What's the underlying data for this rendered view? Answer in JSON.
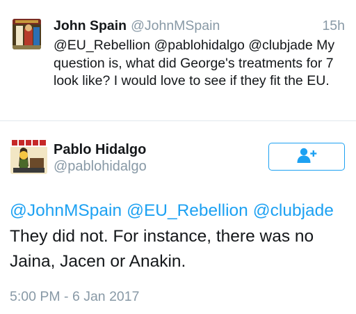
{
  "reply_tweet": {
    "author_name": "John Spain",
    "author_handle": "@JohnMSpain",
    "time_ago": "15h",
    "text": "@EU_Rebellion @pablohidalgo @clubjade My question is, what did George's treatments for 7 look like?  I would love to see if they fit the EU."
  },
  "main_tweet": {
    "author_name": "Pablo Hidalgo",
    "author_handle": "@pablohidalgo",
    "follow_icon": "add-user-icon",
    "mentions": [
      "@JohnMSpain",
      "@EU_Rebellion",
      "@clubjade"
    ],
    "text": "They did not. For instance, there was no Jaina, Jacen or Anakin.",
    "timestamp": "5:00 PM - 6 Jan 2017"
  },
  "colors": {
    "link": "#1da1f2",
    "muted": "#8899a6",
    "text": "#14171a",
    "divider": "#e1e8ed"
  }
}
